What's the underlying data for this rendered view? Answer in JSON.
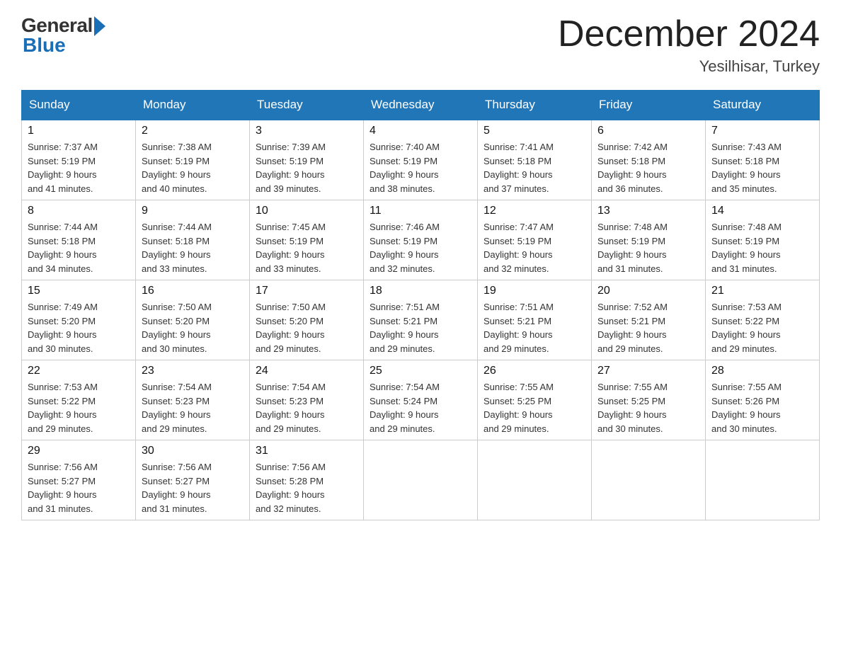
{
  "header": {
    "logo_general": "General",
    "logo_blue": "Blue",
    "month_title": "December 2024",
    "location": "Yesilhisar, Turkey"
  },
  "days_of_week": [
    "Sunday",
    "Monday",
    "Tuesday",
    "Wednesday",
    "Thursday",
    "Friday",
    "Saturday"
  ],
  "weeks": [
    [
      {
        "day": "1",
        "sunrise": "7:37 AM",
        "sunset": "5:19 PM",
        "daylight": "9 hours and 41 minutes."
      },
      {
        "day": "2",
        "sunrise": "7:38 AM",
        "sunset": "5:19 PM",
        "daylight": "9 hours and 40 minutes."
      },
      {
        "day": "3",
        "sunrise": "7:39 AM",
        "sunset": "5:19 PM",
        "daylight": "9 hours and 39 minutes."
      },
      {
        "day": "4",
        "sunrise": "7:40 AM",
        "sunset": "5:19 PM",
        "daylight": "9 hours and 38 minutes."
      },
      {
        "day": "5",
        "sunrise": "7:41 AM",
        "sunset": "5:18 PM",
        "daylight": "9 hours and 37 minutes."
      },
      {
        "day": "6",
        "sunrise": "7:42 AM",
        "sunset": "5:18 PM",
        "daylight": "9 hours and 36 minutes."
      },
      {
        "day": "7",
        "sunrise": "7:43 AM",
        "sunset": "5:18 PM",
        "daylight": "9 hours and 35 minutes."
      }
    ],
    [
      {
        "day": "8",
        "sunrise": "7:44 AM",
        "sunset": "5:18 PM",
        "daylight": "9 hours and 34 minutes."
      },
      {
        "day": "9",
        "sunrise": "7:44 AM",
        "sunset": "5:18 PM",
        "daylight": "9 hours and 33 minutes."
      },
      {
        "day": "10",
        "sunrise": "7:45 AM",
        "sunset": "5:19 PM",
        "daylight": "9 hours and 33 minutes."
      },
      {
        "day": "11",
        "sunrise": "7:46 AM",
        "sunset": "5:19 PM",
        "daylight": "9 hours and 32 minutes."
      },
      {
        "day": "12",
        "sunrise": "7:47 AM",
        "sunset": "5:19 PM",
        "daylight": "9 hours and 32 minutes."
      },
      {
        "day": "13",
        "sunrise": "7:48 AM",
        "sunset": "5:19 PM",
        "daylight": "9 hours and 31 minutes."
      },
      {
        "day": "14",
        "sunrise": "7:48 AM",
        "sunset": "5:19 PM",
        "daylight": "9 hours and 31 minutes."
      }
    ],
    [
      {
        "day": "15",
        "sunrise": "7:49 AM",
        "sunset": "5:20 PM",
        "daylight": "9 hours and 30 minutes."
      },
      {
        "day": "16",
        "sunrise": "7:50 AM",
        "sunset": "5:20 PM",
        "daylight": "9 hours and 30 minutes."
      },
      {
        "day": "17",
        "sunrise": "7:50 AM",
        "sunset": "5:20 PM",
        "daylight": "9 hours and 29 minutes."
      },
      {
        "day": "18",
        "sunrise": "7:51 AM",
        "sunset": "5:21 PM",
        "daylight": "9 hours and 29 minutes."
      },
      {
        "day": "19",
        "sunrise": "7:51 AM",
        "sunset": "5:21 PM",
        "daylight": "9 hours and 29 minutes."
      },
      {
        "day": "20",
        "sunrise": "7:52 AM",
        "sunset": "5:21 PM",
        "daylight": "9 hours and 29 minutes."
      },
      {
        "day": "21",
        "sunrise": "7:53 AM",
        "sunset": "5:22 PM",
        "daylight": "9 hours and 29 minutes."
      }
    ],
    [
      {
        "day": "22",
        "sunrise": "7:53 AM",
        "sunset": "5:22 PM",
        "daylight": "9 hours and 29 minutes."
      },
      {
        "day": "23",
        "sunrise": "7:54 AM",
        "sunset": "5:23 PM",
        "daylight": "9 hours and 29 minutes."
      },
      {
        "day": "24",
        "sunrise": "7:54 AM",
        "sunset": "5:23 PM",
        "daylight": "9 hours and 29 minutes."
      },
      {
        "day": "25",
        "sunrise": "7:54 AM",
        "sunset": "5:24 PM",
        "daylight": "9 hours and 29 minutes."
      },
      {
        "day": "26",
        "sunrise": "7:55 AM",
        "sunset": "5:25 PM",
        "daylight": "9 hours and 29 minutes."
      },
      {
        "day": "27",
        "sunrise": "7:55 AM",
        "sunset": "5:25 PM",
        "daylight": "9 hours and 30 minutes."
      },
      {
        "day": "28",
        "sunrise": "7:55 AM",
        "sunset": "5:26 PM",
        "daylight": "9 hours and 30 minutes."
      }
    ],
    [
      {
        "day": "29",
        "sunrise": "7:56 AM",
        "sunset": "5:27 PM",
        "daylight": "9 hours and 31 minutes."
      },
      {
        "day": "30",
        "sunrise": "7:56 AM",
        "sunset": "5:27 PM",
        "daylight": "9 hours and 31 minutes."
      },
      {
        "day": "31",
        "sunrise": "7:56 AM",
        "sunset": "5:28 PM",
        "daylight": "9 hours and 32 minutes."
      },
      null,
      null,
      null,
      null
    ]
  ],
  "labels": {
    "sunrise": "Sunrise:",
    "sunset": "Sunset:",
    "daylight": "Daylight:"
  }
}
